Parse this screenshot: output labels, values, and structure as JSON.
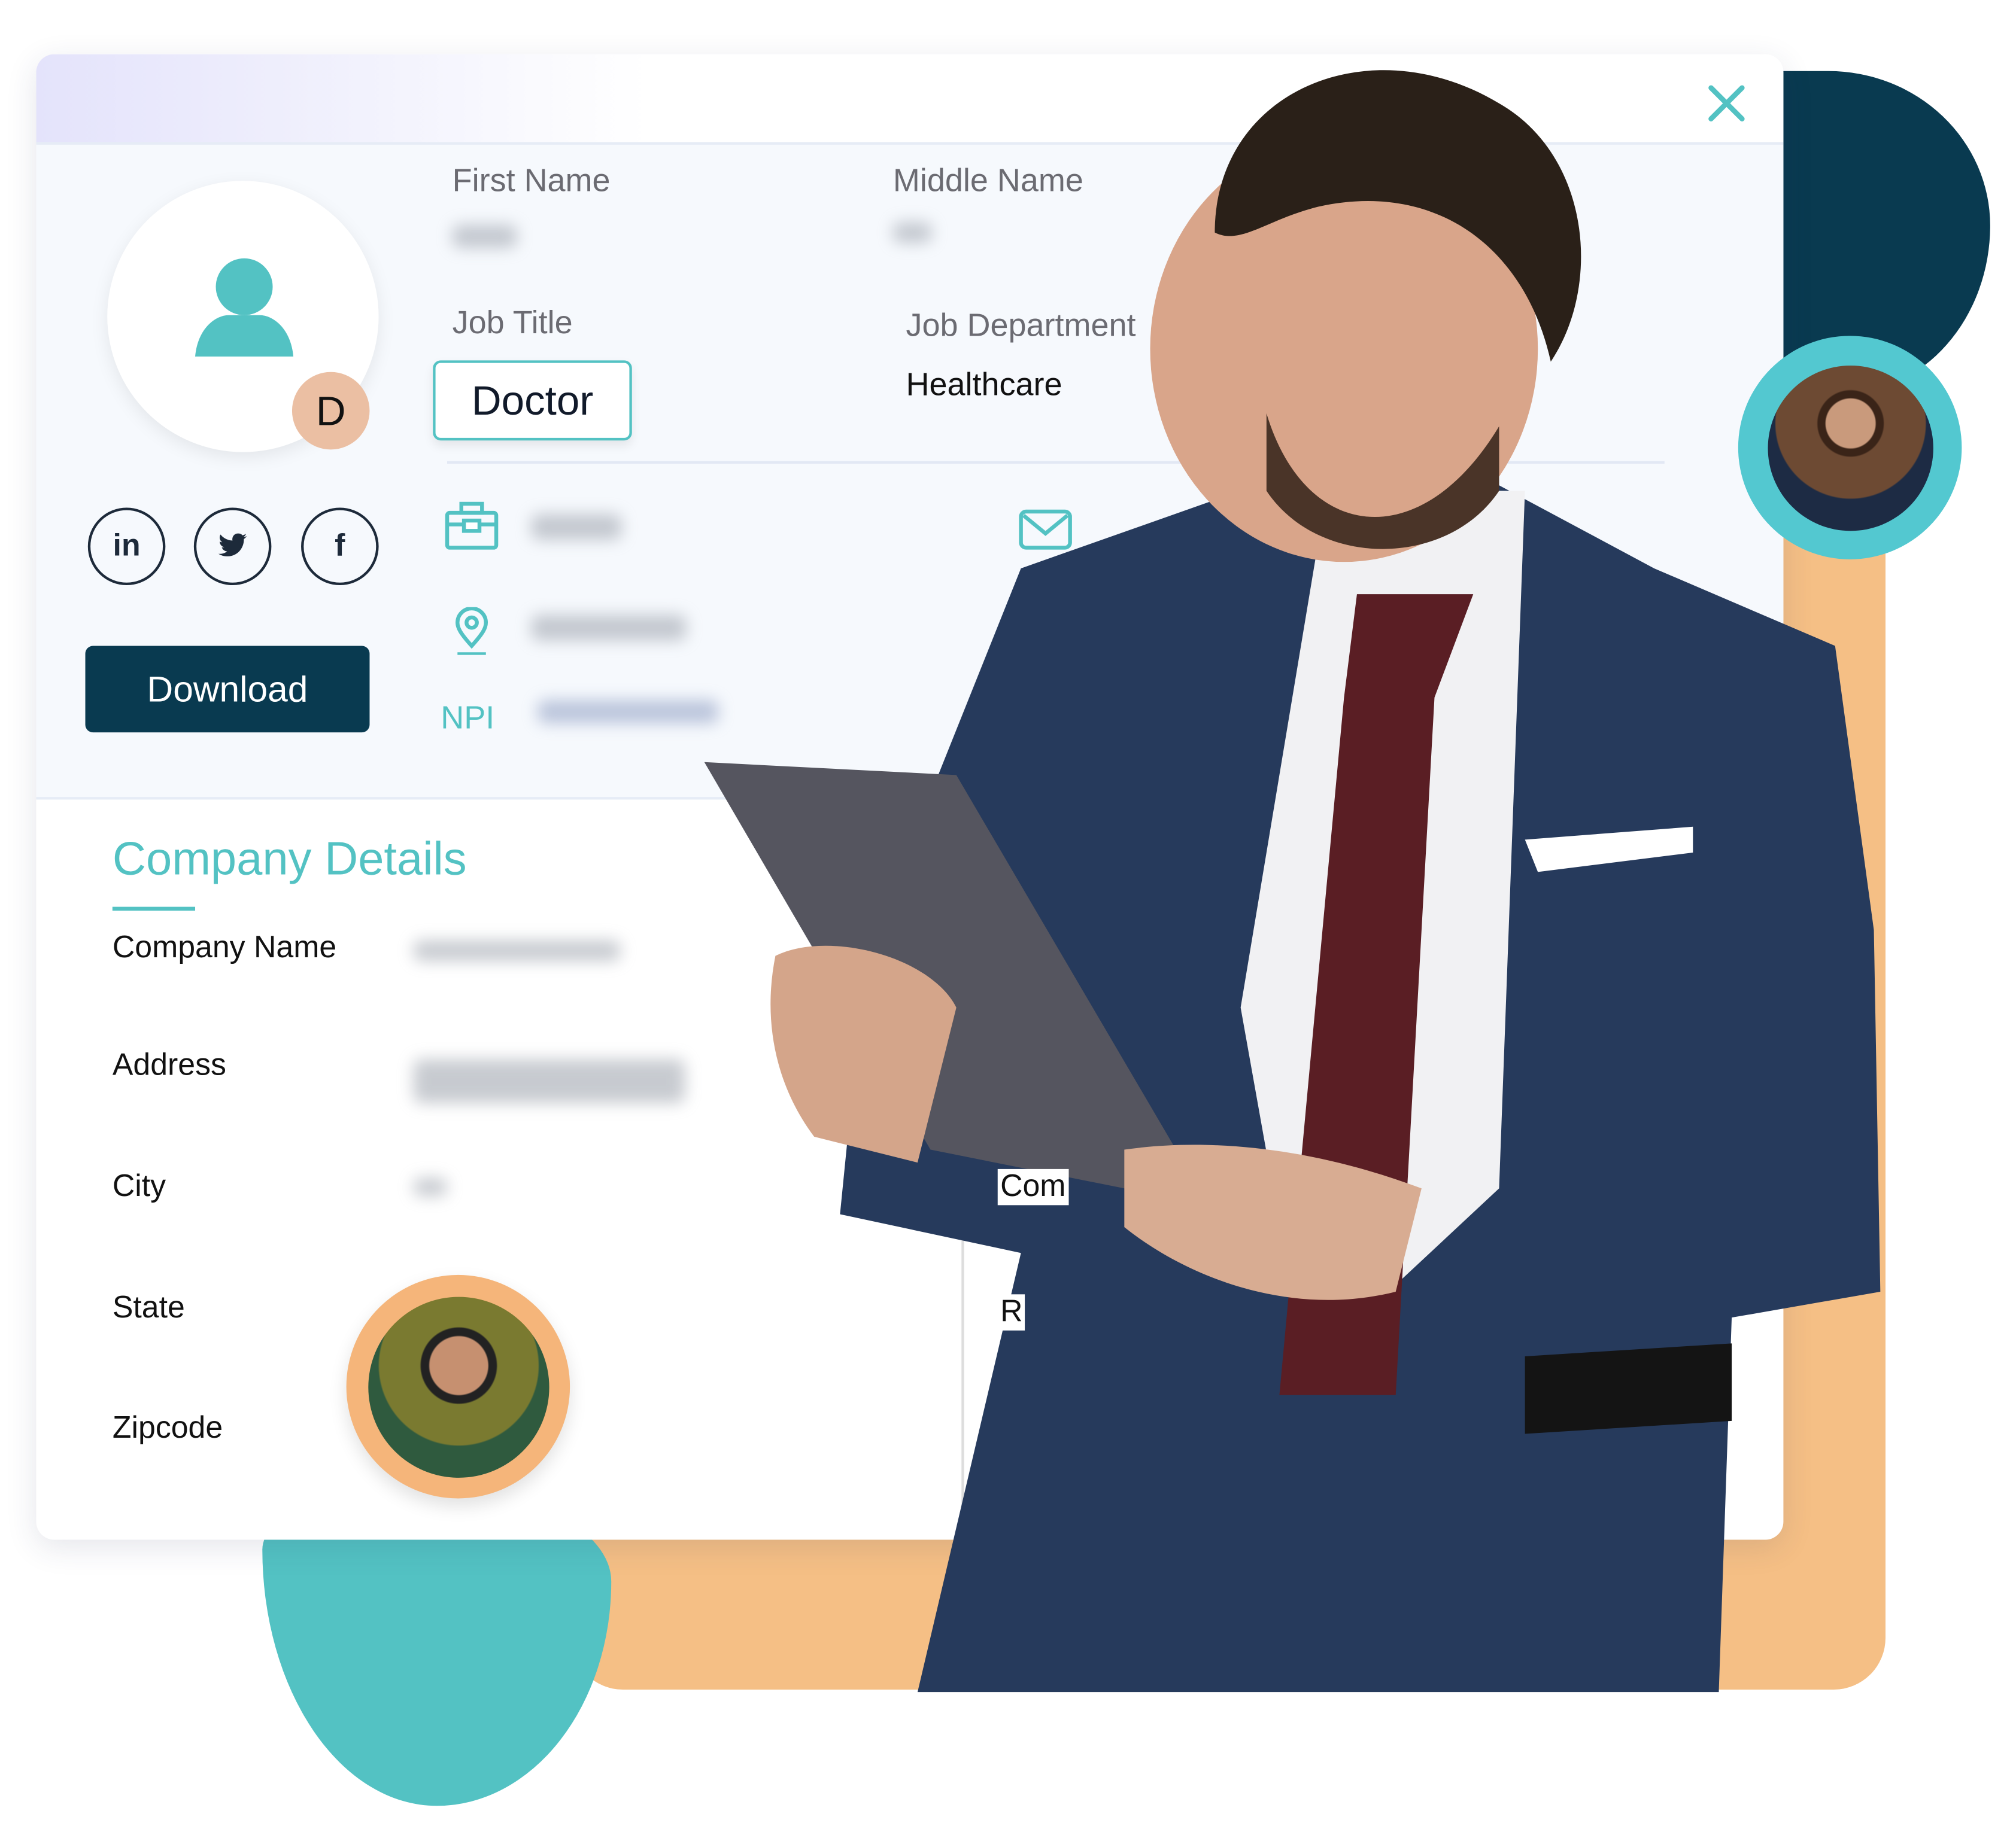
{
  "colors": {
    "teal": "#53c2c3",
    "navy": "#0b3d52",
    "peach": "#f5bf85",
    "initial_badge": "#ebbfa3",
    "dark_teal": "#093a50"
  },
  "window": {
    "close_icon": "close-icon"
  },
  "profile": {
    "avatar_initial": "D",
    "first_name_label": "First Name",
    "middle_name_label": "Middle Name",
    "job_title_label": "Job Title",
    "job_title_value": "Doctor",
    "job_department_label": "Job Department",
    "job_department_value": "Healthcare",
    "npi_label": "NPI",
    "social": {
      "linkedin": "in",
      "twitter": "twitter-icon",
      "facebook": "f"
    },
    "download_label": "Download"
  },
  "company": {
    "title": "Company Details",
    "fields": [
      "Company Name",
      "Address",
      "City",
      "State",
      "Zipcode"
    ],
    "right_partial_labels": [
      "Com",
      "R"
    ]
  }
}
